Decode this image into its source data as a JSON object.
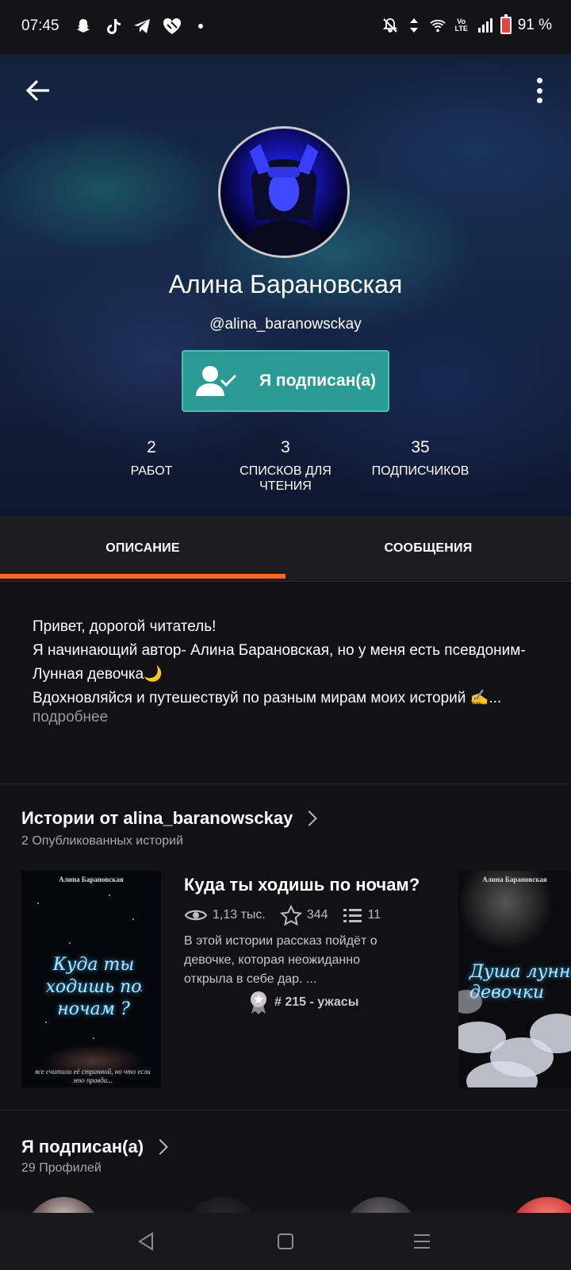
{
  "status_bar": {
    "time": "07:45",
    "left_icons": [
      "snapchat-icon",
      "tiktok-icon",
      "telegram-icon",
      "heart-icon",
      "dot-icon"
    ],
    "right_icons": [
      "mute-icon",
      "data-arrows-icon",
      "wifi-icon",
      "volte-icon",
      "signal-icon",
      "battery-icon"
    ],
    "battery": "91 %"
  },
  "profile": {
    "name": "Алина Барановская",
    "handle": "@alina_baranowsckay",
    "follow_button": "Я подписан(а)",
    "stats": [
      {
        "value": "2",
        "label": "РАБОТ"
      },
      {
        "value": "3",
        "label": "СПИСКОВ ДЛЯ ЧТЕНИЯ"
      },
      {
        "value": "35",
        "label": "ПОДПИСЧИКОВ"
      }
    ]
  },
  "tabs": [
    {
      "label": "ОПИСАНИЕ",
      "active": true
    },
    {
      "label": "СООБЩЕНИЯ",
      "active": false
    }
  ],
  "description": {
    "line1": "Привет, дорогой читатель!",
    "line2": "Я начинающий автор- Алина Барановская, но у меня есть псевдоним- Лунная девочка🌙",
    "line3": "Вдохновляйся и путешествуй по разным мирам моих историй ✍...",
    "more": "подробнее"
  },
  "stories_section": {
    "title": "Истории от alina_baranowsckay",
    "subtitle": "2 Опубликованных историй",
    "stories": [
      {
        "cover_author": "Алина Барановская",
        "cover_title": "Куда ты ходишь по ночам ?",
        "cover_tagline": "все считали её странной, но что если это правда...",
        "title": "Куда ты ходишь по ночам?",
        "reads": "1,13 тыс.",
        "votes": "344",
        "parts": "11",
        "description": "В этой истории рассказ пойдёт о девочке, которая неожиданно открыла в себе дар. ...",
        "rank": "# 215 - ужасы"
      },
      {
        "cover_author": "Алина Барановская",
        "cover_title": "Душа лунной девочки"
      }
    ]
  },
  "following_section": {
    "title": "Я подписан(а)",
    "subtitle": "29 Профилей"
  },
  "nav": {
    "back": "back-triangle-icon",
    "home": "home-square-icon",
    "recents": "recents-menu-icon"
  }
}
